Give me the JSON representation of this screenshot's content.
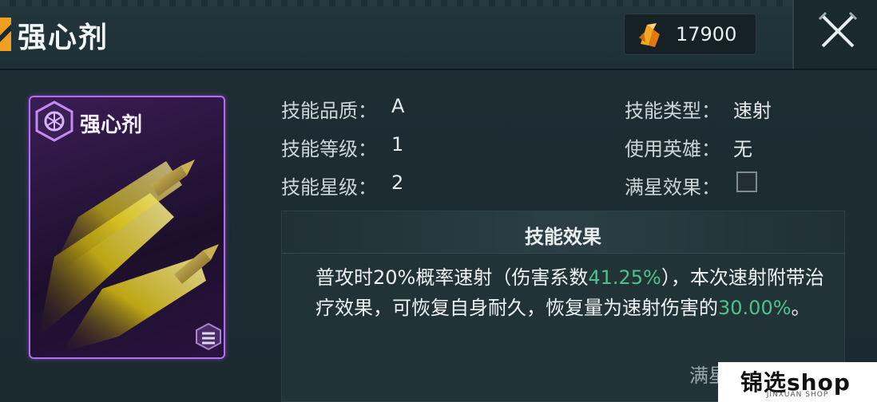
{
  "header": {
    "title": "强心剂",
    "currency_amount": "17900",
    "currency_icon": "orange-crystal-icon",
    "close_icon": "crossed-swords-close-icon"
  },
  "card": {
    "name": "强心剂",
    "frame_color": "#b36df0",
    "art": "twin-flaming-bullets-icon"
  },
  "info": {
    "quality_label": "技能品质：",
    "quality_value": "A",
    "level_label": "技能等级：",
    "level_value": "1",
    "star_label": "技能星级：",
    "star_value": "2",
    "type_label": "技能类型：",
    "type_value": "速射",
    "hero_label": "使用英雄：",
    "hero_value": "无",
    "maxstar_label": "满星效果：",
    "maxstar_checked": false
  },
  "effect": {
    "title": "技能效果",
    "text_part1": "普攻时20%概率速射（伤害系数",
    "text_highlight1": "41.25%",
    "text_part2": "），本次速射附带治疗效果，可恢复自身耐久，恢复量为速射伤害的",
    "text_highlight2": "30.00%",
    "text_part3": "。",
    "highlight_color": "#4ec28b",
    "footer_label": "满星"
  },
  "watermark": {
    "text": "锦选shop",
    "subtext": "JINXUAN SHOP"
  }
}
